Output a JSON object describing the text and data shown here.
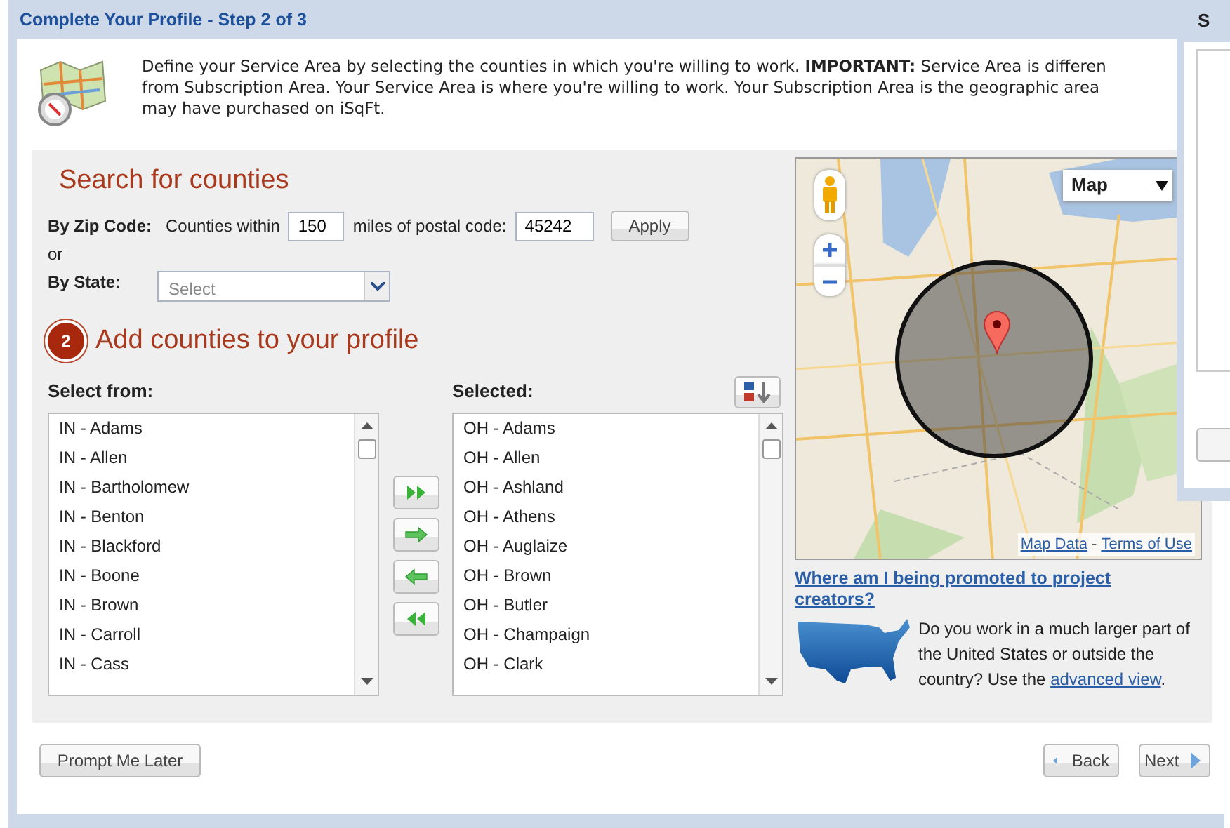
{
  "dialog": {
    "title": "Complete Your Profile - Step 2 of 3"
  },
  "intro": {
    "lines": [
      "Define your Service Area by selecting the counties in which you're willing to work. **IMPORTANT:** Service Area is differen",
      "from Subscription Area. Your Service Area is where you're willing to work. Your Subscription Area is the geographic area",
      "may have purchased on iSqFt."
    ]
  },
  "search": {
    "heading": "Search for counties",
    "zip_label": "By Zip Code:",
    "within_label": "Counties within",
    "radius": "150",
    "postal_label": "miles of postal code:",
    "postal_code": "45242",
    "apply": "Apply",
    "or": "or",
    "state_label": "By State:",
    "state_placeholder": "Select"
  },
  "step": {
    "number": "2",
    "heading": "Add counties to your profile"
  },
  "available": {
    "label": "Select from:",
    "items": [
      "IN - Adams",
      "IN - Allen",
      "IN - Bartholomew",
      "IN - Benton",
      "IN - Blackford",
      "IN - Boone",
      "IN - Brown",
      "IN - Carroll",
      "IN - Cass"
    ]
  },
  "selected": {
    "label": "Selected:",
    "items": [
      "OH - Adams",
      "OH - Allen",
      "OH - Ashland",
      "OH - Athens",
      "OH - Auglaize",
      "OH - Brown",
      "OH - Butler",
      "OH - Champaign",
      "OH - Clark"
    ]
  },
  "transfer_buttons": [
    {
      "kind": "add-all"
    },
    {
      "kind": "add"
    },
    {
      "kind": "remove"
    },
    {
      "kind": "remove-all"
    }
  ],
  "map": {
    "type_label": "Map",
    "map_data": "Map Data",
    "separator": "-",
    "terms": "Terms of Use"
  },
  "promo": {
    "link": "Where am I being promoted to project creators?",
    "text_before": "Do you work in a much larger part of the United States or outside the country? Use the ",
    "link_inline": "advanced view",
    "text_after": "."
  },
  "footer": {
    "later": "Prompt Me Later",
    "back": "Back",
    "next": "Next"
  },
  "other_window": {
    "title": "S"
  }
}
